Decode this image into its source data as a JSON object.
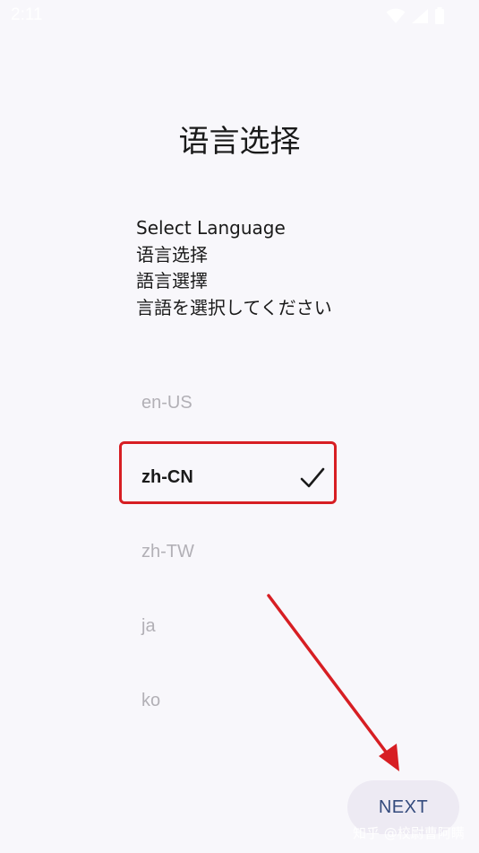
{
  "status_bar": {
    "time": "2:11",
    "icons": [
      "wifi-icon",
      "signal-icon",
      "battery-icon"
    ]
  },
  "title": "语言选择",
  "subtitle_lines": [
    "Select Language",
    "语言选择",
    "語言選擇",
    "言語を選択してください"
  ],
  "languages": [
    {
      "code": "en-US",
      "selected": false
    },
    {
      "code": "zh-CN",
      "selected": true
    },
    {
      "code": "zh-TW",
      "selected": false
    },
    {
      "code": "ja",
      "selected": false
    },
    {
      "code": "ko",
      "selected": false
    }
  ],
  "next_label": "NEXT",
  "watermark": "知乎 @校尉曹阿瞒",
  "colors": {
    "background": "#f8f7fb",
    "annotation_red": "#d71e23",
    "next_text": "#344b7d",
    "next_bg": "#edeaf3",
    "unselected_text": "#b2b0b6"
  }
}
